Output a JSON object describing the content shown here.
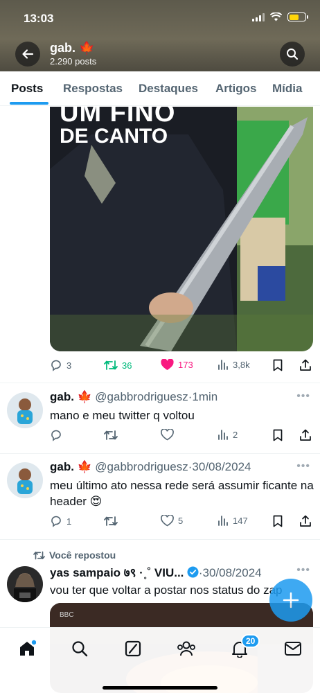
{
  "status_bar": {
    "time": "13:03"
  },
  "header": {
    "name": "gab. 🍁",
    "post_count": "2.290 posts"
  },
  "tabs": [
    {
      "label": "Posts",
      "active": true
    },
    {
      "label": "Respostas"
    },
    {
      "label": "Destaques"
    },
    {
      "label": "Artigos"
    },
    {
      "label": "Mídia"
    }
  ],
  "post1": {
    "image_text_line1": "UM FINO",
    "image_text_line2": "DE CANTO",
    "replies": "3",
    "reposts": "36",
    "likes": "173",
    "views": "3,8k"
  },
  "post2": {
    "name": "gab. 🍁",
    "handle": "@gabbrodriguesz",
    "time": "·1min",
    "text": "mano e meu twitter q voltou",
    "views": "2"
  },
  "post3": {
    "name": "gab. 🍁",
    "handle": "@gabbrodriguesz",
    "time": "·30/08/2024",
    "text": "meu último ato nessa rede será assumir ficante na header 😍",
    "replies": "1",
    "likes": "5",
    "views": "147"
  },
  "post4": {
    "repost_label": "Você repostou",
    "name": "yas sampaio ७९ ·˳˚ VIU...",
    "time": "·30/08/2024",
    "text": "vou ter que voltar a postar nos status do zap"
  },
  "bottom_nav": {
    "notifications_badge": "20"
  },
  "colors": {
    "accent": "#1d9bf0",
    "like": "#f91880",
    "repost": "#00ba7c",
    "muted": "#536471"
  }
}
